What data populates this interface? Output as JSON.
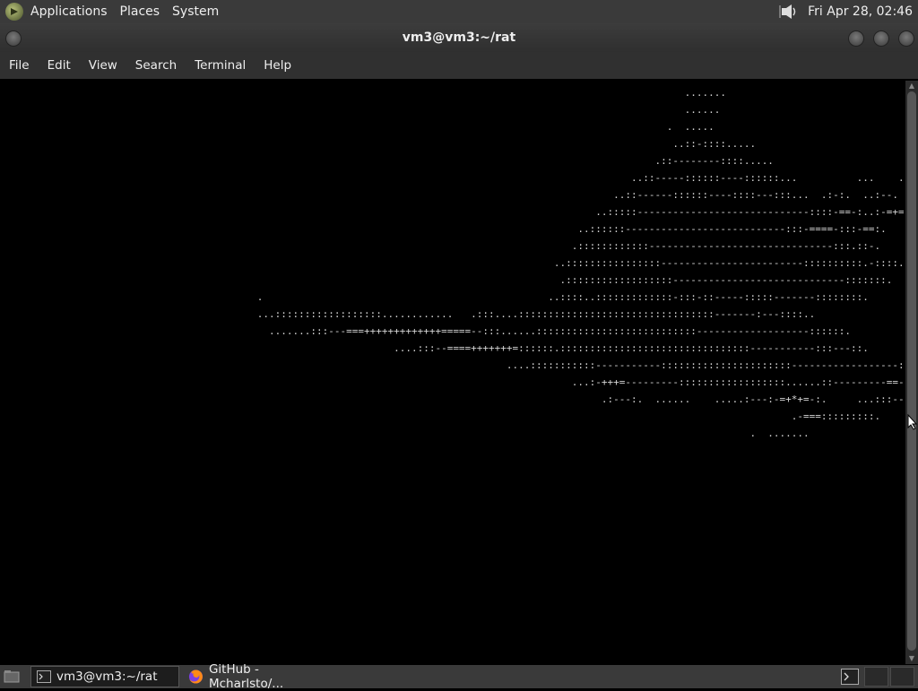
{
  "top_panel": {
    "menus": [
      "Applications",
      "Places",
      "System"
    ],
    "clock": "Fri Apr 28, 02:46"
  },
  "window": {
    "title": "vm3@vm3:~/rat"
  },
  "menubar": {
    "items": [
      "File",
      "Edit",
      "View",
      "Search",
      "Terminal",
      "Help"
    ]
  },
  "terminal": {
    "lines": [
      "                                                                                                                   .......",
      "                                                                                                                   ......",
      "                                                                                                                .  .....",
      "                                                                                                                 ..::-::::.....",
      "                                                                                                              .::--------::::.....",
      "                                                                                                          ..::-----::::::----::::::...          ...    ..",
      "                                                                                                       ..::------::::::----::::---:::...  .:-:.  ..:--.",
      "                                                                                                    ..:::::-----------------------------::::-==-:..:-=+=:",
      "                                                                                                 ..::::::---------------------------:::-====-:::-==:.",
      "                                                                                                .::::::::::::-------------------------------:::.::-.",
      "                                                                                             ..::::::::::::::::------------------------::::::::::.-::::.",
      "                                                                                              .::::::::::::::::::-----------------------------:::::::.",
      "                                           .                                                ..::::..:::::::::::::-:::-::-----:::::-------::::::::.",
      "                                           ...::::::::::::::::::............   .:::....:::::::::::::::::::::::::::::::::-------:---::::..",
      "                                             .......:::---===+++++++++++++=====--:::......:::::::::::::::::::::::::::-------------------::::::.",
      "                                                                  ....:::--====+++++++=::::::.::::::::::::::::::::::::::::::::-----------:::---::.",
      "                                                                                     ....:::::::::::-----------::::::::::::::::::::::------------------:",
      "                                                                                                ...:-+++=---------::::::::::::::::::......::---------==-",
      "                                                                                                     .:---:.  ......    .....:---:-=+*+=-:.     ...:::---::",
      "                                                                                                                                     .-===:::::::::.          ...",
      "                                                                                                                              .  ......."
    ]
  },
  "taskbar": {
    "tasks": [
      "vm3@vm3:~/rat",
      "GitHub - Mcharlsto/..."
    ]
  }
}
